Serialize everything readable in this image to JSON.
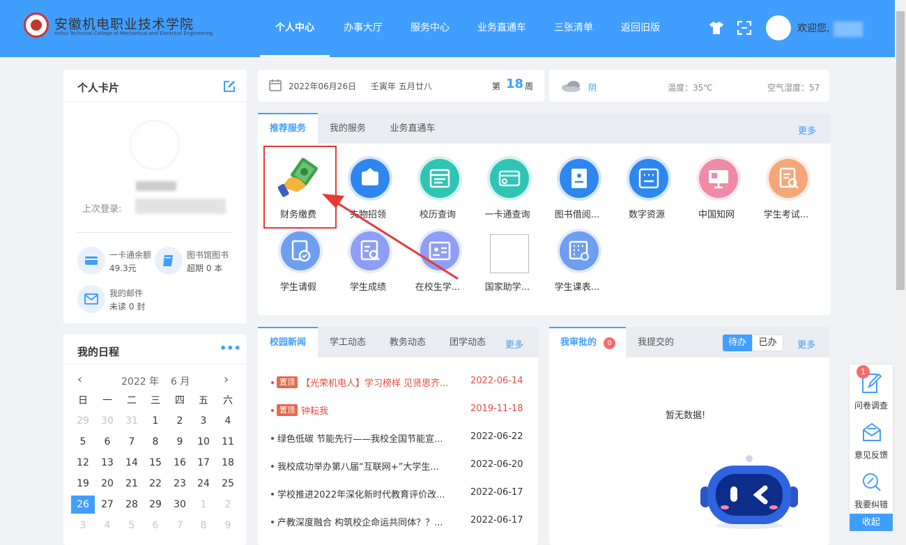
{
  "header": {
    "logo_cn": "安徽机电职业技术学院",
    "logo_en": "Anhui Technical College of Mechanical and Electrical Engineering",
    "nav": [
      "个人中心",
      "办事大厅",
      "服务中心",
      "业务直通车",
      "三张清单",
      "返回旧版"
    ],
    "welcome": "欢迎您,"
  },
  "profile": {
    "title": "个人卡片",
    "last_login_label": "上次登录:",
    "stats": [
      {
        "label": "一卡通余额",
        "value": "49.3元",
        "icon": "card-icon"
      },
      {
        "label": "图书馆图书",
        "value": "超期 0 本",
        "icon": "book-icon"
      },
      {
        "label": "我的邮件",
        "value": "未读 0 封",
        "icon": "mail-icon"
      }
    ]
  },
  "schedule": {
    "title": "我的日程",
    "more": "•••",
    "year": "2022 年",
    "month": "6 月",
    "weekdays": [
      "日",
      "一",
      "二",
      "三",
      "四",
      "五",
      "六"
    ],
    "days": [
      {
        "d": "29",
        "m": true
      },
      {
        "d": "30",
        "m": true
      },
      {
        "d": "31",
        "m": true
      },
      {
        "d": "1"
      },
      {
        "d": "2"
      },
      {
        "d": "3"
      },
      {
        "d": "4"
      },
      {
        "d": "5"
      },
      {
        "d": "6"
      },
      {
        "d": "7"
      },
      {
        "d": "8"
      },
      {
        "d": "9"
      },
      {
        "d": "10"
      },
      {
        "d": "11"
      },
      {
        "d": "12"
      },
      {
        "d": "13"
      },
      {
        "d": "14"
      },
      {
        "d": "15"
      },
      {
        "d": "16"
      },
      {
        "d": "17"
      },
      {
        "d": "18"
      },
      {
        "d": "19"
      },
      {
        "d": "20"
      },
      {
        "d": "21"
      },
      {
        "d": "22"
      },
      {
        "d": "23"
      },
      {
        "d": "24"
      },
      {
        "d": "25"
      },
      {
        "d": "26",
        "t": true
      },
      {
        "d": "27"
      },
      {
        "d": "28"
      },
      {
        "d": "29"
      },
      {
        "d": "30"
      },
      {
        "d": "1",
        "m": true
      },
      {
        "d": "2",
        "m": true
      },
      {
        "d": "3",
        "m": true
      },
      {
        "d": "4",
        "m": true
      },
      {
        "d": "5",
        "m": true
      },
      {
        "d": "6",
        "m": true
      },
      {
        "d": "7",
        "m": true
      },
      {
        "d": "8",
        "m": true
      },
      {
        "d": "9",
        "m": true
      }
    ]
  },
  "datebar": {
    "date": "2022年06月26日",
    "lunar": "壬寅年 五月廿八",
    "week_prefix": "第",
    "week_number": "18",
    "week_suffix": "周"
  },
  "weather": {
    "condition": "阴",
    "temperature": "温度：35℃",
    "humidity": "空气湿度：57"
  },
  "services": {
    "tabs": [
      "推荐服务",
      "我的服务",
      "业务直通车"
    ],
    "more": "更多",
    "items": [
      {
        "label": "财务缴费",
        "icon": "money-hand-icon",
        "color": "#ffffff"
      },
      {
        "label": "失物招领",
        "icon": "lost-found-icon",
        "color": "#2e86ef"
      },
      {
        "label": "校历查询",
        "icon": "calendar-icon",
        "color": "#2fc5b5"
      },
      {
        "label": "一卡通查询",
        "icon": "card-icon",
        "color": "#2fc5b5"
      },
      {
        "label": "图书借阅...",
        "icon": "book-icon",
        "color": "#2e86ef"
      },
      {
        "label": "数字资源",
        "icon": "resource-icon",
        "color": "#2e86ef"
      },
      {
        "label": "中国知网",
        "icon": "presentation-icon",
        "color": "#f08aa6"
      },
      {
        "label": "学生考试...",
        "icon": "exam-icon",
        "color": "#f6a77a"
      },
      {
        "label": "学生请假",
        "icon": "leave-icon",
        "color": "#6e9ef0"
      },
      {
        "label": "学生成绩",
        "icon": "grade-icon",
        "color": "#8e9ef4"
      },
      {
        "label": "在校生学...",
        "icon": "student-id-icon",
        "color": "#8e9ef4"
      },
      {
        "label": "国家助学...",
        "icon": "blank-icon",
        "color": "#ffffff"
      },
      {
        "label": "学生课表...",
        "icon": "timetable-icon",
        "color": "#6e9ef0"
      }
    ]
  },
  "news": {
    "tabs": [
      "校园新闻",
      "学工动态",
      "教务动态",
      "团学动态"
    ],
    "more": "更多",
    "pinned_label": "置顶",
    "items": [
      {
        "title": "【光荣机电人】学习榜样 见贤思齐...",
        "date": "2022-06-14",
        "pinned": true
      },
      {
        "title": "钟耘我",
        "date": "2019-11-18",
        "pinned": true
      },
      {
        "title": "绿色低碳 节能先行——我校全国节能宣...",
        "date": "2022-06-22"
      },
      {
        "title": "我校成功举办第八届“互联网+”大学生...",
        "date": "2022-06-20"
      },
      {
        "title": "学校推进2022年深化新时代教育评价改...",
        "date": "2022-06-17"
      },
      {
        "title": "产教深度融合 构筑校企命运共同体？？...",
        "date": "2022-06-17"
      }
    ]
  },
  "approval": {
    "tabs": [
      "我审批的",
      "我提交的"
    ],
    "count": "0",
    "todo": "待办",
    "done": "已办",
    "more": "更多",
    "empty": "暂无数据!"
  },
  "side": {
    "badge": "1",
    "survey": "问卷调查",
    "feedback": "意见反馈",
    "correction": "我要纠错",
    "collapse": "收起"
  },
  "colors": {
    "accent": "#409eff",
    "alert": "#e94b3c"
  }
}
